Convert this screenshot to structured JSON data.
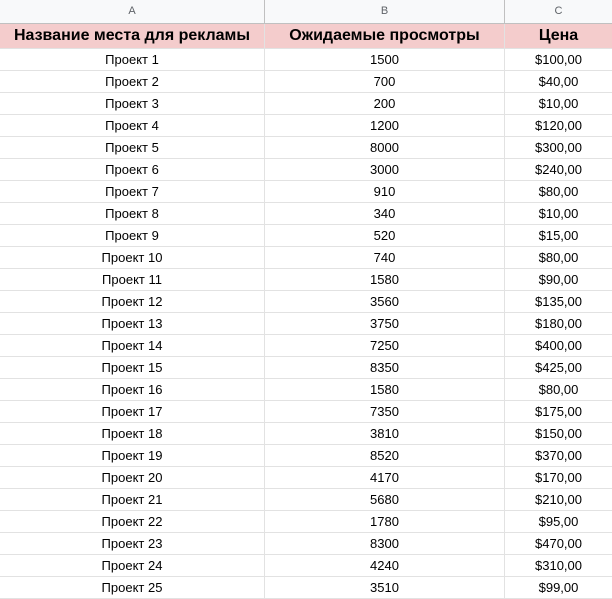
{
  "columns": {
    "a": "A",
    "b": "B",
    "c": "C"
  },
  "headers": {
    "name": "Название места для рекламы",
    "views": "Ожидаемые просмотры",
    "price": "Цена"
  },
  "rows": [
    {
      "name": "Проект 1",
      "views": "1500",
      "price": "$100,00"
    },
    {
      "name": "Проект 2",
      "views": "700",
      "price": "$40,00"
    },
    {
      "name": "Проект 3",
      "views": "200",
      "price": "$10,00"
    },
    {
      "name": "Проект 4",
      "views": "1200",
      "price": "$120,00"
    },
    {
      "name": "Проект 5",
      "views": "8000",
      "price": "$300,00"
    },
    {
      "name": "Проект 6",
      "views": "3000",
      "price": "$240,00"
    },
    {
      "name": "Проект 7",
      "views": "910",
      "price": "$80,00"
    },
    {
      "name": "Проект 8",
      "views": "340",
      "price": "$10,00"
    },
    {
      "name": "Проект 9",
      "views": "520",
      "price": "$15,00"
    },
    {
      "name": "Проект 10",
      "views": "740",
      "price": "$80,00"
    },
    {
      "name": "Проект 11",
      "views": "1580",
      "price": "$90,00"
    },
    {
      "name": "Проект 12",
      "views": "3560",
      "price": "$135,00"
    },
    {
      "name": "Проект 13",
      "views": "3750",
      "price": "$180,00"
    },
    {
      "name": "Проект 14",
      "views": "7250",
      "price": "$400,00"
    },
    {
      "name": "Проект 15",
      "views": "8350",
      "price": "$425,00"
    },
    {
      "name": "Проект 16",
      "views": "1580",
      "price": "$80,00"
    },
    {
      "name": "Проект 17",
      "views": "7350",
      "price": "$175,00"
    },
    {
      "name": "Проект 18",
      "views": "3810",
      "price": "$150,00"
    },
    {
      "name": "Проект 19",
      "views": "8520",
      "price": "$370,00"
    },
    {
      "name": "Проект 20",
      "views": "4170",
      "price": "$170,00"
    },
    {
      "name": "Проект 21",
      "views": "5680",
      "price": "$210,00"
    },
    {
      "name": "Проект 22",
      "views": "1780",
      "price": "$95,00"
    },
    {
      "name": "Проект 23",
      "views": "8300",
      "price": "$470,00"
    },
    {
      "name": "Проект 24",
      "views": "4240",
      "price": "$310,00"
    },
    {
      "name": "Проект 25",
      "views": "3510",
      "price": "$99,00"
    }
  ]
}
